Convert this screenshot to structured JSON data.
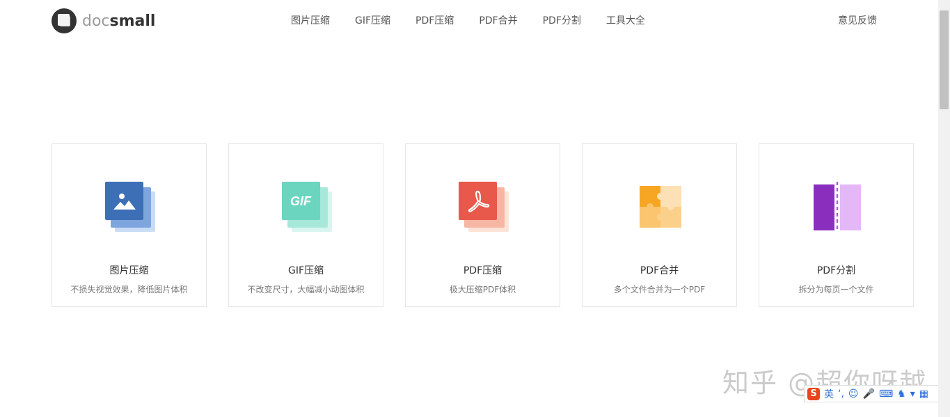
{
  "brand": {
    "left": "doc",
    "right": "small"
  },
  "nav": [
    "图片压缩",
    "GIF压缩",
    "PDF压缩",
    "PDF合并",
    "PDF分割",
    "工具大全"
  ],
  "feedback": "意见反馈",
  "cards": [
    {
      "title": "图片压缩",
      "desc": "不损失视觉效果，降低图片体积",
      "icon": "image-icon"
    },
    {
      "title": "GIF压缩",
      "desc": "不改变尺寸，大幅减小动图体积",
      "icon": "gif-icon"
    },
    {
      "title": "PDF压缩",
      "desc": "极大压缩PDF体积",
      "icon": "pdf-icon"
    },
    {
      "title": "PDF合并",
      "desc": "多个文件合并为一个PDF",
      "icon": "puzzle-icon"
    },
    {
      "title": "PDF分割",
      "desc": "拆分为每页一个文件",
      "icon": "split-icon"
    }
  ],
  "gif_badge": "GIF",
  "watermark": "知乎 @超你呀越",
  "ime": {
    "lang": "英"
  },
  "colors": {
    "image": "#3d6fb6",
    "gif": "#6bd5c0",
    "pdf": "#e8594b",
    "merge": "#f6a623",
    "split": "#8a2fbd"
  }
}
